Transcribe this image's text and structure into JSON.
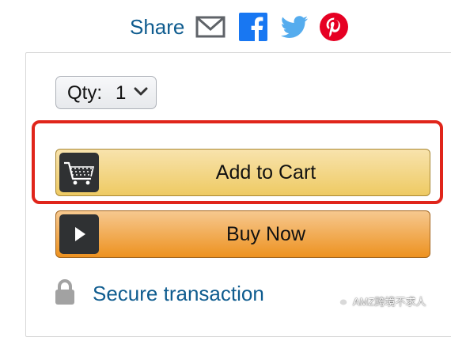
{
  "share": {
    "label": "Share",
    "icons": [
      "email-icon",
      "facebook-icon",
      "twitter-icon",
      "pinterest-icon"
    ]
  },
  "quantity": {
    "label": "Qty:",
    "value": "1"
  },
  "buttons": {
    "add_to_cart": "Add to Cart",
    "buy_now": "Buy Now"
  },
  "secure": {
    "label": "Secure transaction"
  },
  "watermark": {
    "text": "AMZ跨境不求人"
  },
  "colors": {
    "link": "#0F5C8F",
    "add_to_cart": "#F0CC6A",
    "buy_now": "#ED9220",
    "highlight": "#E0251B",
    "facebook": "#1877F2",
    "twitter": "#55ACEE",
    "pinterest": "#E60023"
  }
}
